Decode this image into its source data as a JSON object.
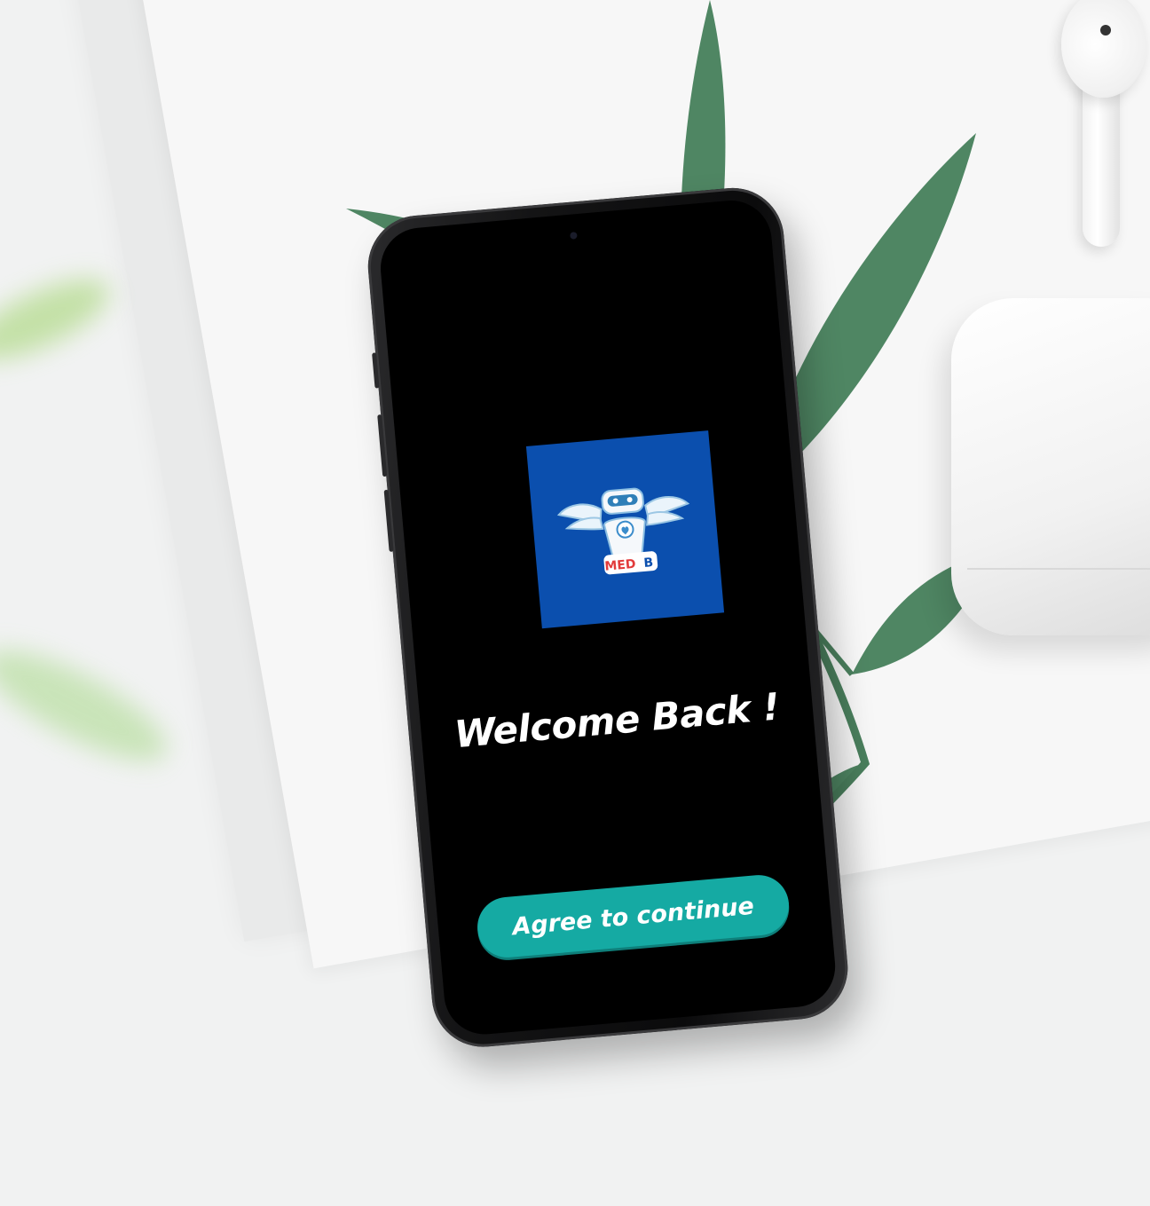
{
  "app": {
    "name": "MED B"
  },
  "logo": {
    "text_med": "MED",
    "text_b": "B",
    "background": "#0b4fae",
    "accent": "#e23b3b"
  },
  "welcome": {
    "title": "Welcome Back !"
  },
  "cta": {
    "label": "Agree to continue",
    "color": "#15aaa3"
  },
  "theme": {
    "screen_background": "#000000",
    "text_color": "#ffffff"
  },
  "icons": {
    "logo": "robot-angel-icon"
  }
}
